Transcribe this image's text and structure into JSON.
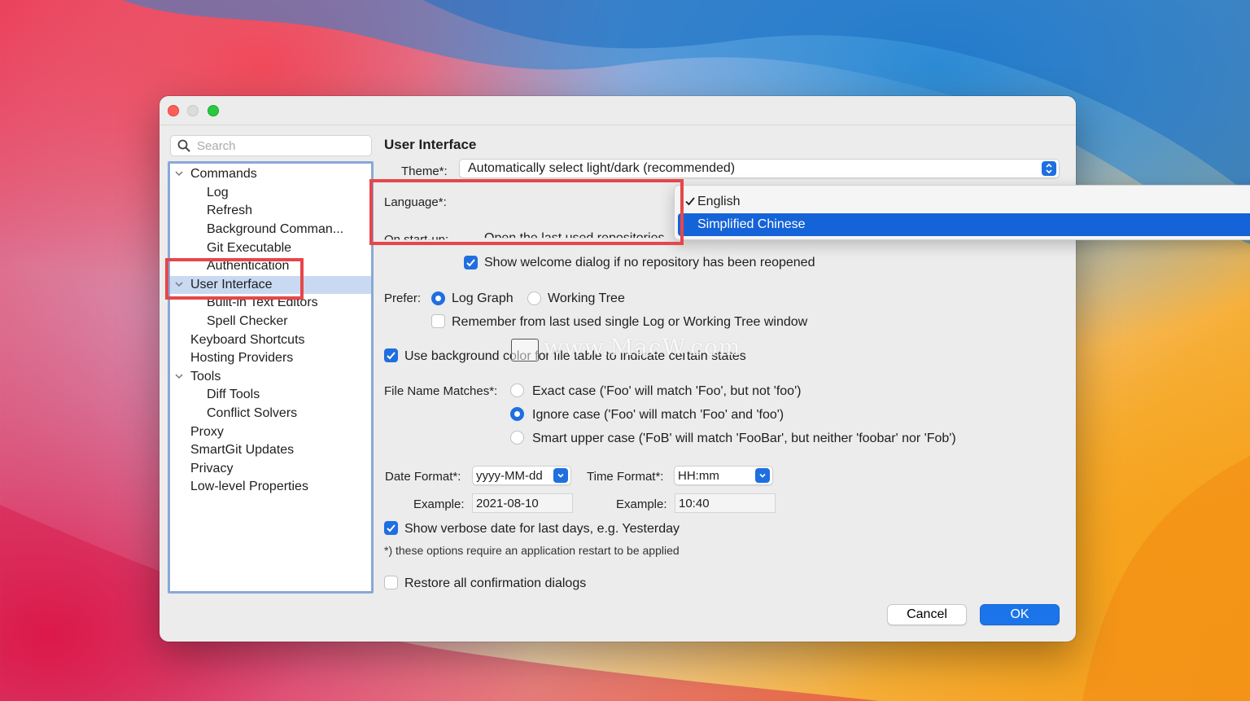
{
  "search": {
    "placeholder": "Search"
  },
  "tree": [
    {
      "label": "Commands",
      "level": 0,
      "expandable": true
    },
    {
      "label": "Log",
      "level": 1
    },
    {
      "label": "Refresh",
      "level": 1
    },
    {
      "label": "Background Comman...",
      "level": 1
    },
    {
      "label": "Git Executable",
      "level": 1
    },
    {
      "label": "Authentication",
      "level": 1
    },
    {
      "label": "User Interface",
      "level": 0,
      "expandable": true,
      "selected": true
    },
    {
      "label": "Built-in Text Editors",
      "level": 1
    },
    {
      "label": "Spell Checker",
      "level": 1
    },
    {
      "label": "Keyboard Shortcuts",
      "level": 0
    },
    {
      "label": "Hosting Providers",
      "level": 0
    },
    {
      "label": "Tools",
      "level": 0,
      "expandable": true
    },
    {
      "label": "Diff Tools",
      "level": 1
    },
    {
      "label": "Conflict Solvers",
      "level": 1
    },
    {
      "label": "Proxy",
      "level": 0
    },
    {
      "label": "SmartGit Updates",
      "level": 0
    },
    {
      "label": "Privacy",
      "level": 0
    },
    {
      "label": "Low-level Properties",
      "level": 0
    }
  ],
  "panel": {
    "title": "User Interface",
    "theme_label": "Theme*:",
    "theme_value": "Automatically select light/dark (recommended)",
    "language_label": "Language*:",
    "language_options": [
      "English",
      "Simplified Chinese"
    ],
    "language_selected": "English",
    "language_highlighted": "Simplified Chinese",
    "startup_label": "On start-up:",
    "startup_option1": "Open the last used repositories",
    "welcome_dialog": "Show welcome dialog if no repository has been reopened",
    "prefer_label": "Prefer:",
    "prefer_log_graph": "Log Graph",
    "prefer_working_tree": "Working Tree",
    "remember_window": "Remember from last used single Log or Working Tree window",
    "use_background_color": "Use background color for file table to indicate certain states",
    "file_name_label": "File Name Matches*:",
    "exact_case": "Exact case ('Foo' will match 'Foo', but not 'foo')",
    "ignore_case": "Ignore case ('Foo' will match 'Foo' and 'foo')",
    "smart_case": "Smart upper case ('FoB' will match 'FooBar', but neither 'foobar' nor 'Fob')",
    "date_format_label": "Date Format*:",
    "date_format_value": "yyyy-MM-dd",
    "time_format_label": "Time Format*:",
    "time_format_value": "HH:mm",
    "example_label": "Example:",
    "date_example": "2021-08-10",
    "time_example": "10:40",
    "verbose_date": "Show verbose date for last days, e.g. Yesterday",
    "restart_note": "*) these options require an application restart to be applied",
    "restore_dialogs": "Restore all confirmation dialogs"
  },
  "buttons": {
    "cancel": "Cancel",
    "ok": "OK"
  },
  "watermark": "www.MacW.com",
  "colors": {
    "accent": "#1f6fe0",
    "highlight_box": "#e5474b",
    "selection": "#c9d9f2"
  }
}
